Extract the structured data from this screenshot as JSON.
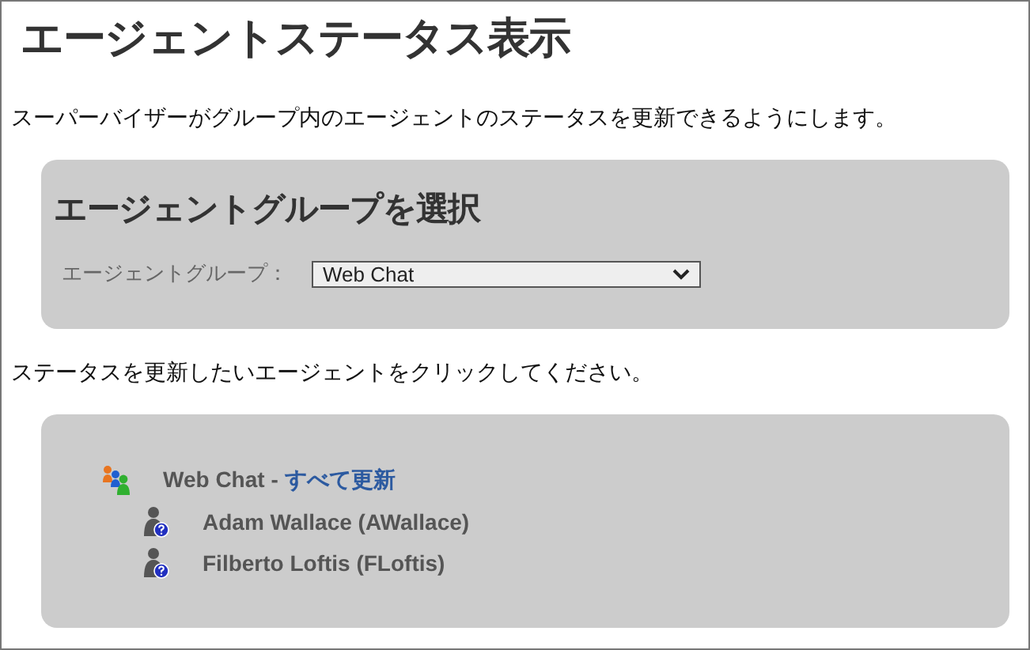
{
  "page": {
    "title": "エージェントステータス表示",
    "description": "スーパーバイザーがグループ内のエージェントのステータスを更新できるようにします。"
  },
  "group_select": {
    "heading": "エージェントグループを選択",
    "label": "エージェントグループ：",
    "value": "Web Chat"
  },
  "instruction": "ステータスを更新したいエージェントをクリックしてください。",
  "tree": {
    "group": "Web Chat - ",
    "update_all": "すべて更新",
    "agents": [
      {
        "name": "Adam Wallace (AWallace)"
      },
      {
        "name": "Filberto Loftis (FLoftis)"
      }
    ]
  }
}
